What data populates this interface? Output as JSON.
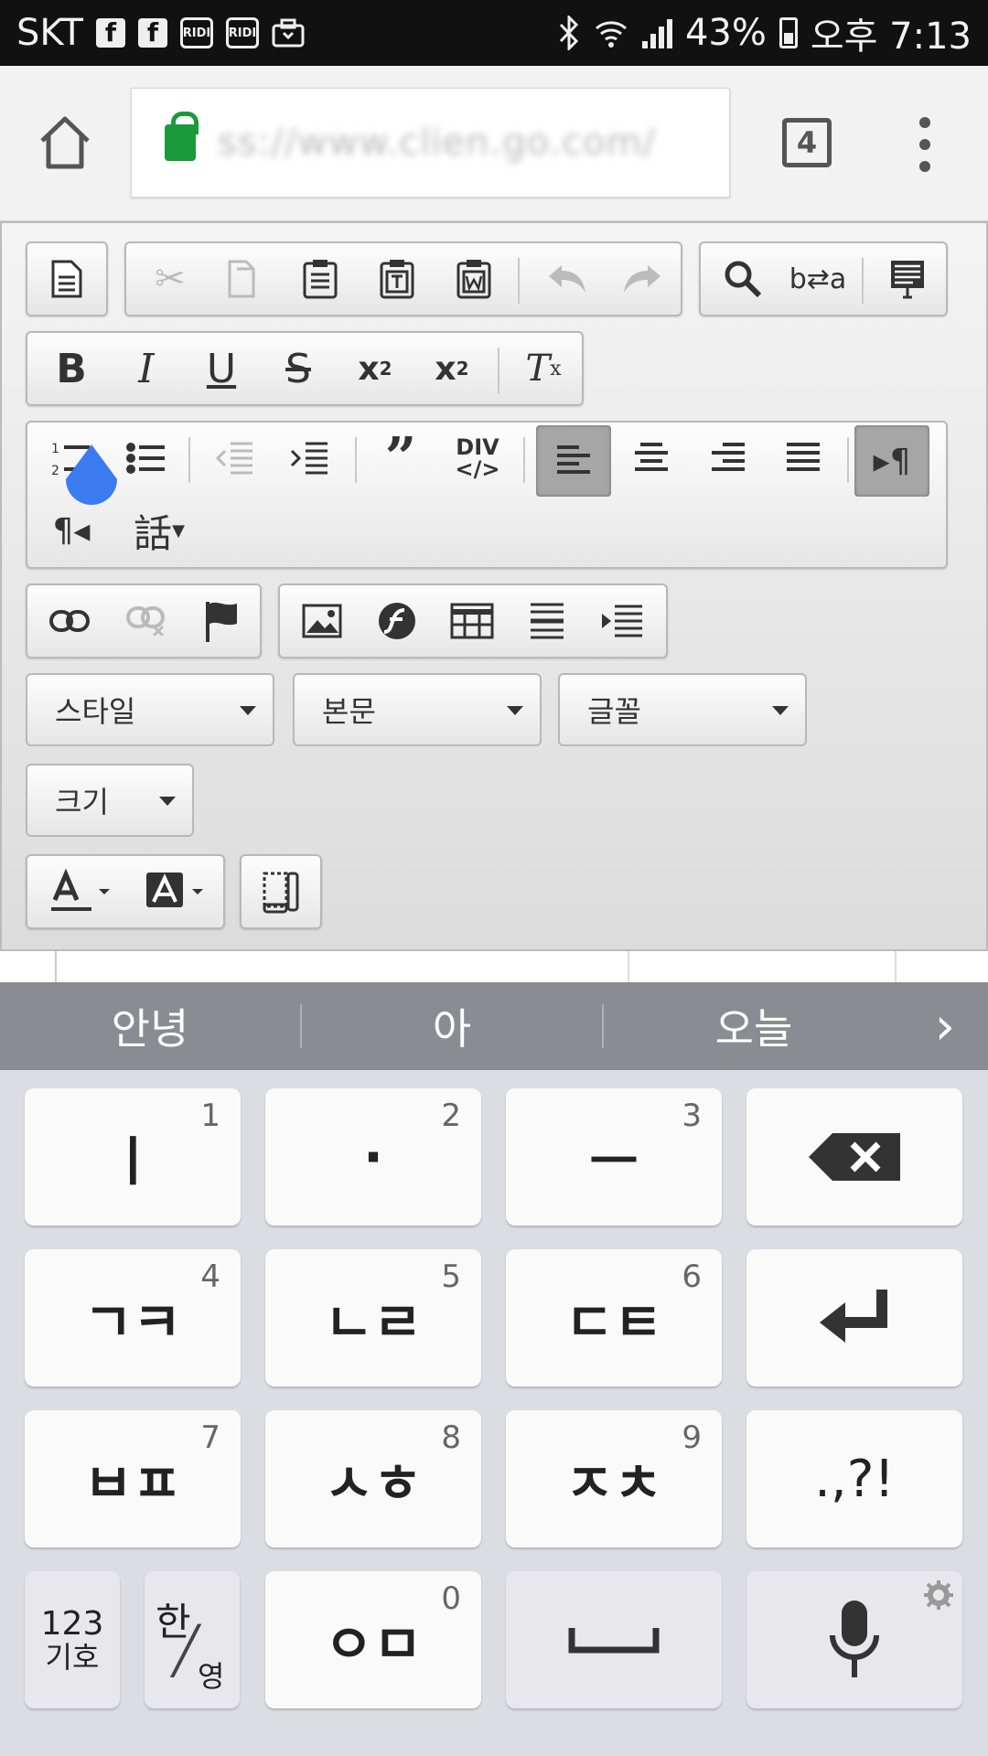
{
  "statusbar": {
    "carrier": "SKT",
    "notif_badge_1": "RIDI",
    "notif_badge_2": "RIDI",
    "battery": "43%",
    "time": "오후 7:13"
  },
  "browser": {
    "url": "ss://www.clien.go.com/",
    "tab_count": "4"
  },
  "editor": {
    "combos": {
      "style": "스타일",
      "format": "본문",
      "font": "글꼴",
      "size": "크기"
    },
    "language_label": "話"
  },
  "suggestions": [
    "안녕",
    "아",
    "오늘"
  ],
  "keyboard": {
    "rows": [
      [
        {
          "label": "ㅣ",
          "num": "1"
        },
        {
          "label": "·",
          "num": "2"
        },
        {
          "label": "ㅡ",
          "num": "3"
        }
      ],
      [
        {
          "label": "ㄱㅋ",
          "num": "4"
        },
        {
          "label": "ㄴㄹ",
          "num": "5"
        },
        {
          "label": "ㄷㅌ",
          "num": "6"
        }
      ],
      [
        {
          "label": "ㅂㅍ",
          "num": "7"
        },
        {
          "label": "ㅅㅎ",
          "num": "8"
        },
        {
          "label": "ㅈㅊ",
          "num": "9"
        }
      ]
    ],
    "punct": ".,?!",
    "num_sym_top": "123",
    "num_sym_bottom": "기호",
    "lang_top": "한",
    "lang_bottom": "영",
    "bottom_center": {
      "label": "ㅇㅁ",
      "num": "0"
    }
  }
}
